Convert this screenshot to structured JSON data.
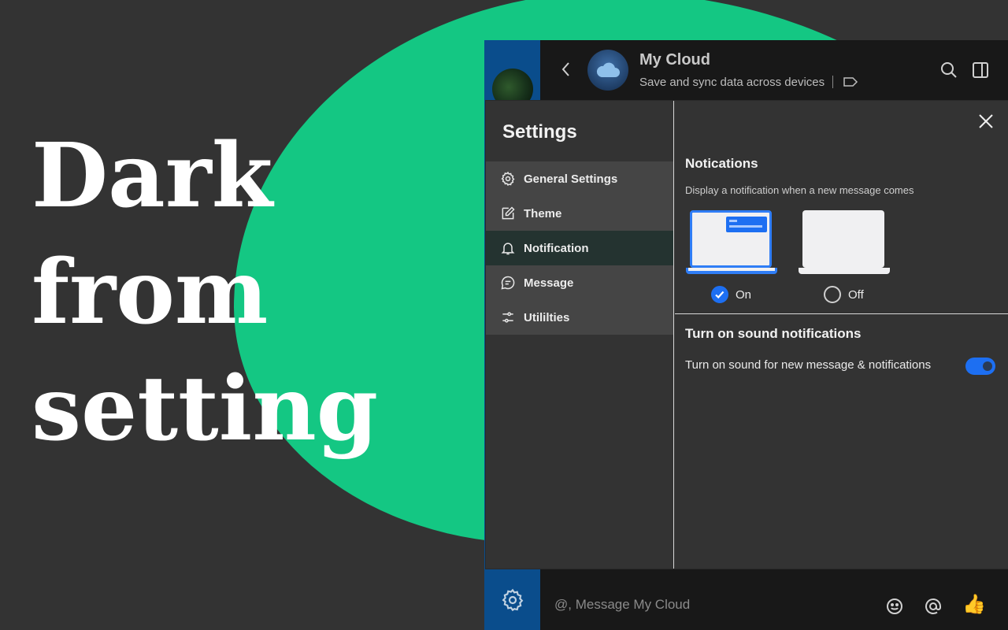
{
  "promo": {
    "headline": "Dark\nfrom\nsetting"
  },
  "colors": {
    "background": "#333333",
    "accent_green": "#14c783",
    "accent_blue": "#1d6ff2",
    "rail_blue": "#0a4d8c"
  },
  "header": {
    "title": "My Cloud",
    "subtitle": "Save and sync data across devices",
    "icons": [
      "back-icon",
      "cloud-icon",
      "tag-icon",
      "search-icon",
      "panel-icon"
    ]
  },
  "settings": {
    "title": "Settings",
    "nav": [
      {
        "label": "General Settings",
        "icon": "gear-icon",
        "active": false
      },
      {
        "label": "Theme",
        "icon": "edit-icon",
        "active": false
      },
      {
        "label": "Notification",
        "icon": "bell-icon",
        "active": true
      },
      {
        "label": "Message",
        "icon": "chat-icon",
        "active": false
      },
      {
        "label": "Utililties",
        "icon": "sliders-icon",
        "active": false
      }
    ],
    "notifications": {
      "title": "Notications",
      "description": "Display a notification when a new message comes",
      "options": [
        {
          "label": "On",
          "selected": true
        },
        {
          "label": "Off",
          "selected": false
        }
      ]
    },
    "sound": {
      "title": "Turn on sound notifications",
      "label": "Turn on sound for new message & notifications",
      "enabled": true
    }
  },
  "composer": {
    "placeholder": "@, Message My Cloud",
    "icons": [
      "emoji-icon",
      "at-icon",
      "thumbs-up-icon"
    ]
  }
}
